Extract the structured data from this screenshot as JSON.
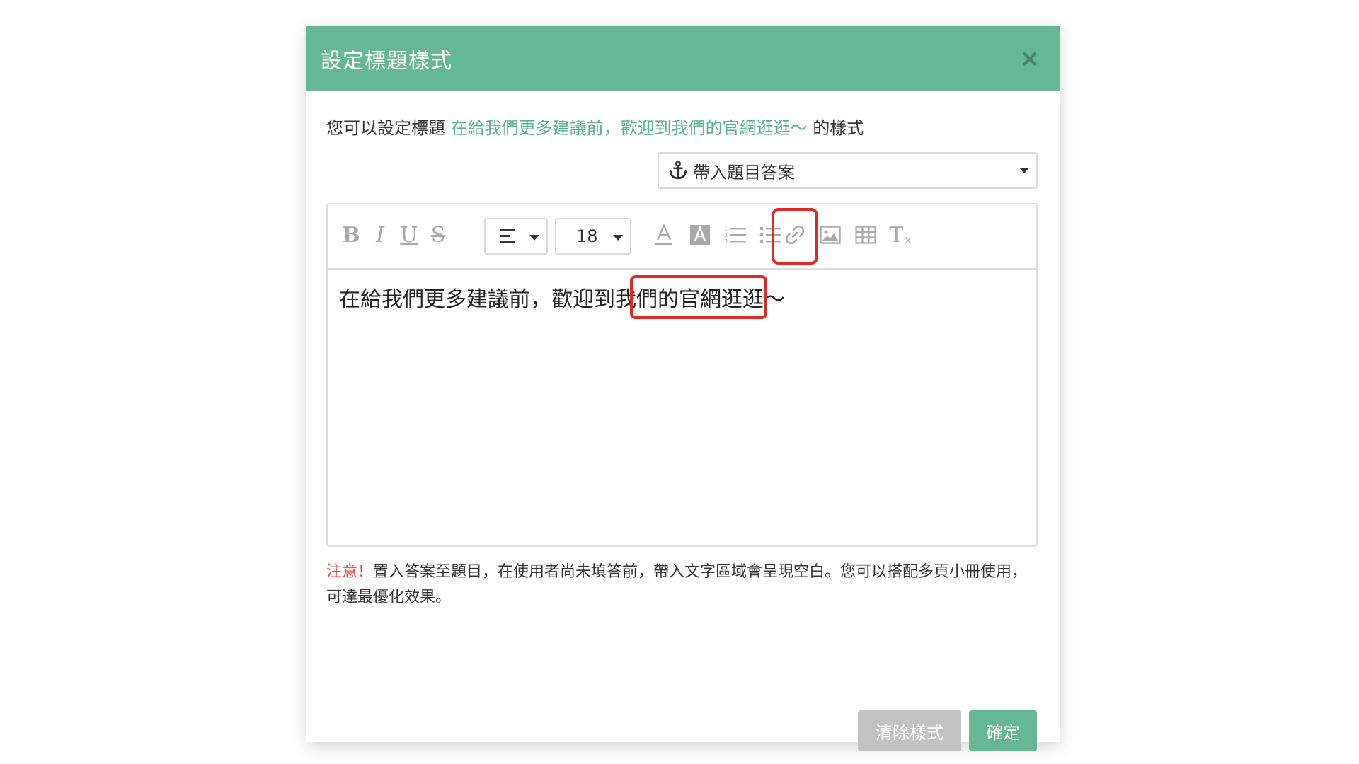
{
  "modal": {
    "title": "設定標題樣式",
    "close_symbol": "×"
  },
  "intro": {
    "prefix": "您可以設定標題 ",
    "highlighted_title": "在給我們更多建議前，歡迎到我們的官網逛逛～",
    "suffix": " 的樣式"
  },
  "answer_dropdown": {
    "icon": "anchor-icon",
    "label": "帶入題目答案"
  },
  "toolbar": {
    "bold": "B",
    "italic": "I",
    "underline": "U",
    "strike": "S",
    "font_size": "18",
    "clear_format": "T"
  },
  "editor": {
    "content": "在給我們更多建議前，歡迎到我們的官網逛逛～"
  },
  "note": {
    "warning": "注意！",
    "text": "置入答案至題目，在使用者尚未填答前，帶入文字區域會呈現空白。您可以搭配多頁小冊使用，可達最優化效果。"
  },
  "buttons": {
    "clear": "清除樣式",
    "confirm": "確定"
  },
  "colors": {
    "header": "#66b795",
    "accent_text": "#56b08f",
    "warning": "#e8453c",
    "highlight_box": "#e02a25",
    "clear_button": "#c2c2c2"
  }
}
